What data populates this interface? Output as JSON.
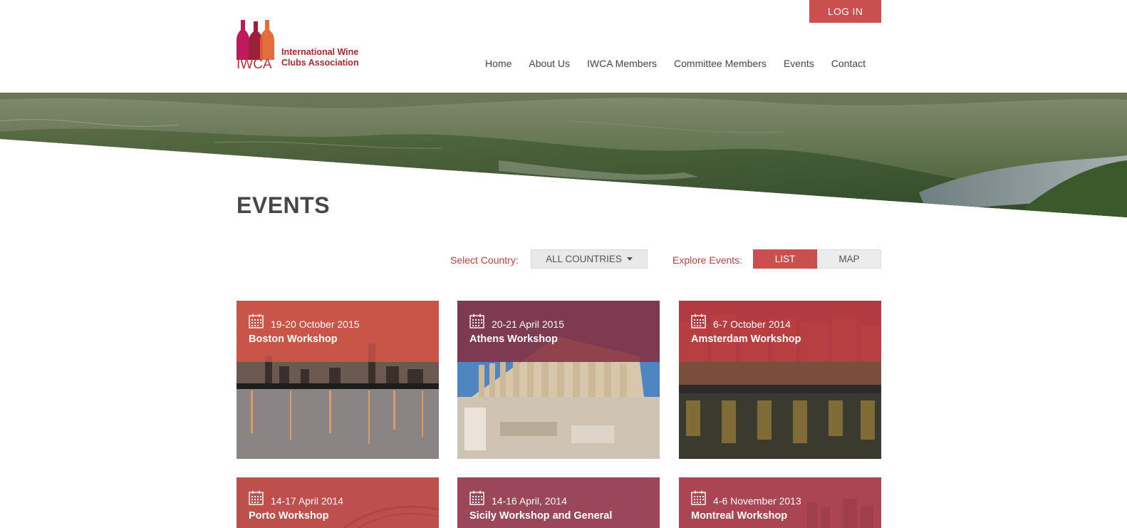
{
  "header": {
    "login_label": "LOG IN",
    "logo_acronym": "IWCA",
    "logo_name_line1": "International Wine",
    "logo_name_line2": "Clubs Association"
  },
  "nav": {
    "items": [
      {
        "label": "Home"
      },
      {
        "label": "About Us"
      },
      {
        "label": "IWCA Members"
      },
      {
        "label": "Committee Members"
      },
      {
        "label": "Events"
      },
      {
        "label": "Contact"
      }
    ]
  },
  "page": {
    "title": "EVENTS"
  },
  "filters": {
    "country_label": "Select Country:",
    "country_value": "ALL COUNTRIES",
    "explore_label": "Explore Events:",
    "list_label": "LIST",
    "map_label": "MAP"
  },
  "events": [
    {
      "date": "19-20 October 2015",
      "title": "Boston Workshop"
    },
    {
      "date": "20-21 April 2015",
      "title": "Athens Workshop"
    },
    {
      "date": "6-7 October 2014",
      "title": "Amsterdam Workshop"
    },
    {
      "date": "14-17 April 2014",
      "title": "Porto Workshop"
    },
    {
      "date": "14-16 April, 2014",
      "title": "Sicily Workshop and General"
    },
    {
      "date": "4-6 November 2013",
      "title": "Montreal Workshop"
    }
  ],
  "colors": {
    "accent": "#c9504e",
    "label_red": "#c0403e",
    "text": "#444444"
  },
  "icons": {
    "calendar": "calendar-icon",
    "dropdown": "caret-down-icon"
  }
}
